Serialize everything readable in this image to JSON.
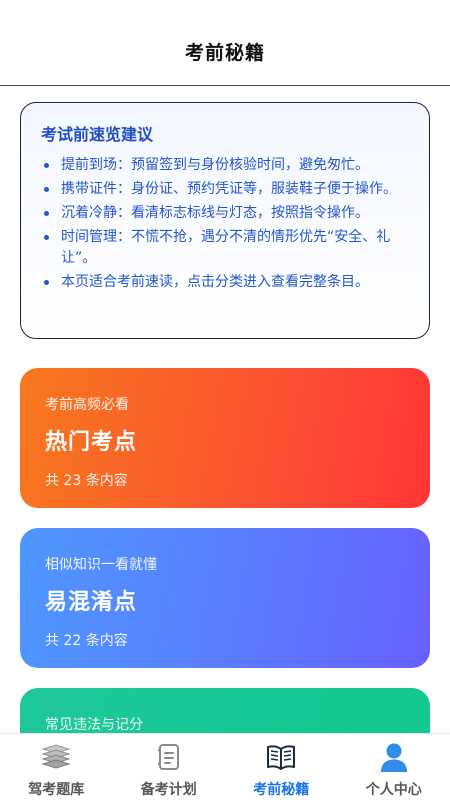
{
  "header": {
    "title": "考前秘籍"
  },
  "tips": {
    "title": "考试前速览建议",
    "items": [
      "提前到场：预留签到与身份核验时间，避免匆忙。",
      "携带证件：身份证、预约凭证等，服装鞋子便于操作。",
      "沉着冷静：看清标志标线与灯态，按照指令操作。",
      "时间管理：不慌不抢，遇分不清的情形优先“安全、礼让”。",
      "本页适合考前速读，点击分类进入查看完整条目。"
    ]
  },
  "cards": [
    {
      "subtitle": "考前高频必看",
      "name": "热门考点",
      "count": "共 23 条内容"
    },
    {
      "subtitle": "相似知识一看就懂",
      "name": "易混淆点",
      "count": "共 22 条内容"
    },
    {
      "subtitle": "常见违法与记分",
      "name": "",
      "count": ""
    }
  ],
  "tabbar": {
    "tabs": [
      {
        "label": "驾考题库",
        "icon": "question-bank-icon",
        "active": false
      },
      {
        "label": "备考计划",
        "icon": "plan-notebook-icon",
        "active": false
      },
      {
        "label": "考前秘籍",
        "icon": "open-book-icon",
        "active": true
      },
      {
        "label": "个人中心",
        "icon": "user-icon",
        "active": false
      }
    ]
  },
  "colors": {
    "accent": "#1a73e8",
    "tips_text": "#2457c9",
    "card_hot_start": "#f7781e",
    "card_hot_end": "#ff3535",
    "card_mix_start": "#4e98ff",
    "card_mix_end": "#6860ff",
    "card_law": "#1ec79a"
  }
}
